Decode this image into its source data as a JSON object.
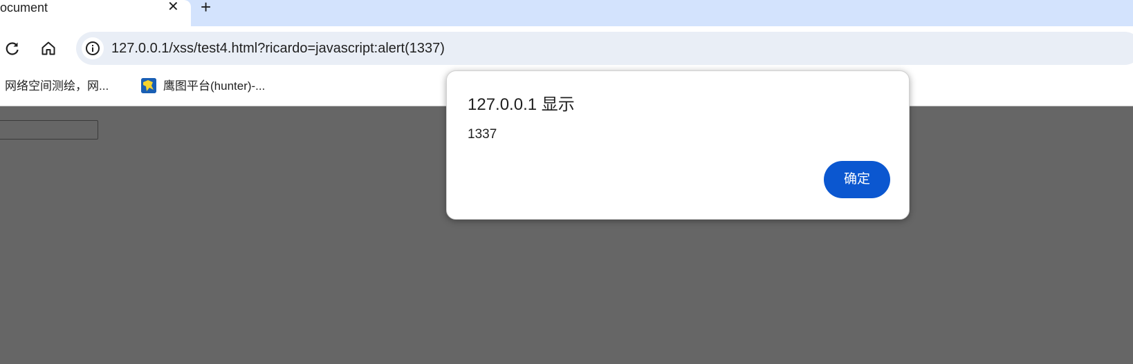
{
  "tab": {
    "title": "ocument",
    "close_label": "✕",
    "new_tab_label": "+"
  },
  "toolbar": {
    "reload_icon": "reload-icon",
    "home_icon": "home-icon",
    "site_info_icon": "info-icon",
    "url_host": "127.0.0.1",
    "url_path": "/xss/test4.html?ricardo=javascript:alert(1337)"
  },
  "bookmarks": {
    "items": [
      {
        "label": "网络空间测绘，网..."
      },
      {
        "label": "鹰图平台(hunter)-..."
      }
    ]
  },
  "dialog": {
    "title": "127.0.0.1 显示",
    "message": "1337",
    "ok_label": "确定",
    "accent_color": "#0b57d0"
  },
  "colors": {
    "tabstrip_bg": "#d3e3fd",
    "omnibox_bg": "#e9eef6",
    "page_overlay": "#666666"
  }
}
